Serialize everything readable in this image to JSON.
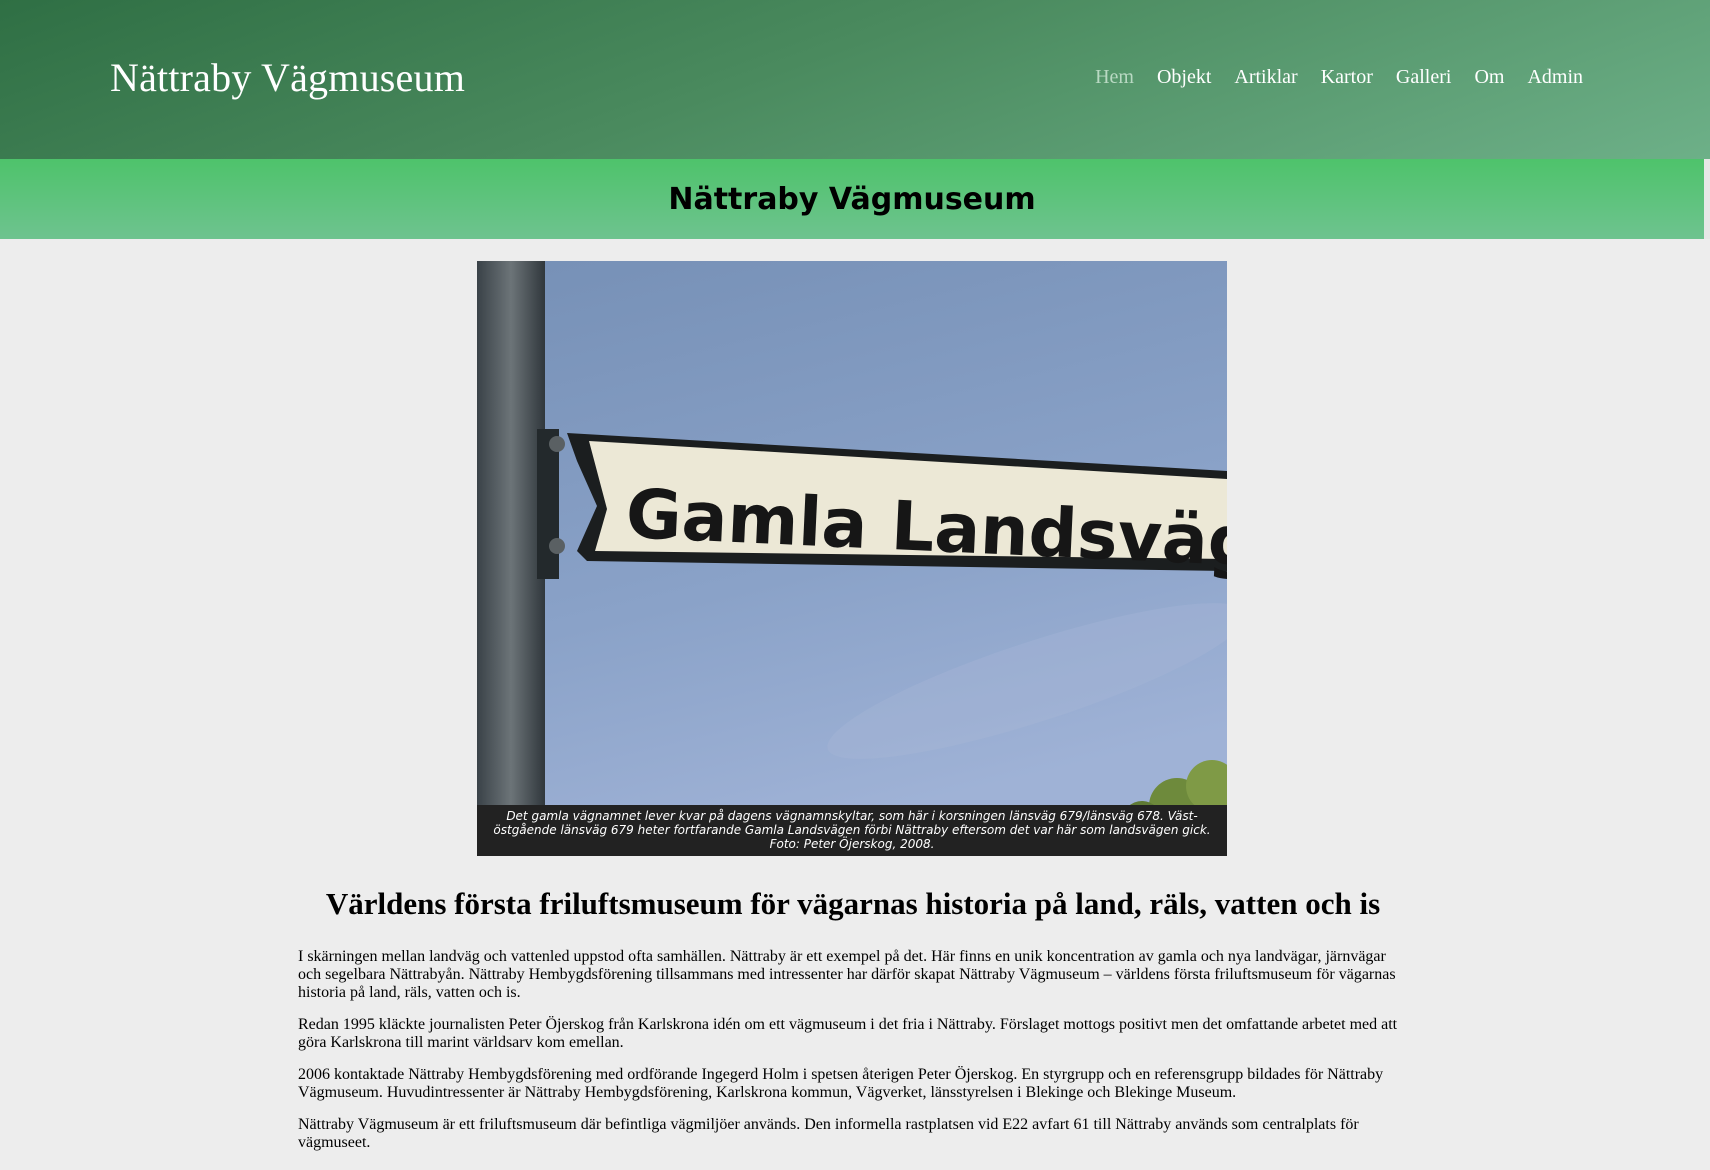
{
  "header": {
    "site_title": "Nättraby Vägmuseum",
    "nav": [
      {
        "label": "Hem"
      },
      {
        "label": "Objekt"
      },
      {
        "label": "Artiklar"
      },
      {
        "label": "Kartor"
      },
      {
        "label": "Galleri"
      },
      {
        "label": "Om"
      },
      {
        "label": "Admin"
      }
    ],
    "active_nav": "Hem"
  },
  "banner": {
    "title": "Nättraby Vägmuseum"
  },
  "figure": {
    "sign_text": "Gamla Landsvägen",
    "caption": "Det gamla vägnamnet lever kvar på dagens vägnamnskyltar, som här i korsningen länsväg 679/länsväg 678. Väst-östgående länsväg 679 heter fortfarande Gamla Landsvägen förbi Nättraby eftersom det var här som landsvägen gick. Foto: Peter Öjerskog, 2008."
  },
  "main": {
    "heading": "Världens första friluftsmuseum för vägarnas historia på land, räls, vatten och is",
    "paragraphs": [
      "I skärningen mellan landväg och vattenled uppstod ofta samhällen. Nättraby är ett exempel på det. Här finns en unik koncentration av gamla och nya landvägar, järnvägar och segelbara Nättrabyån. Nättraby Hembygdsförening tillsammans med intressenter har därför skapat Nättraby Vägmuseum – världens första friluftsmuseum för vägarnas historia på land, räls, vatten och is.",
      "Redan 1995 kläckte journalisten Peter Öjerskog från Karlskrona idén om ett vägmuseum i det fria i Nättraby. Förslaget mottogs positivt men det omfattande arbetet med att göra Karlskrona till marint världsarv kom emellan.",
      "2006 kontaktade Nättraby Hembygdsförening med ordförande Ingegerd Holm i spetsen återigen Peter Öjerskog. En styrgrupp och en referensgrupp bildades för Nättraby Vägmuseum. Huvudintressenter är Nättraby Hembygdsförening, Karlskrona kommun, Vägverket, länsstyrelsen i Blekinge och Blekinge Museum.",
      "Nättraby Vägmuseum är ett friluftsmuseum där befintliga vägmiljöer används. Den informella rastplatsen vid E22 avfart 61 till Nättraby används som centralplats för vägmuseet."
    ]
  },
  "colors": {
    "header_dark": "#2f6f44",
    "header_light": "#6db088",
    "banner_green": "#4ec36b",
    "page_bg": "#ededed",
    "caption_bg": "#222222"
  }
}
